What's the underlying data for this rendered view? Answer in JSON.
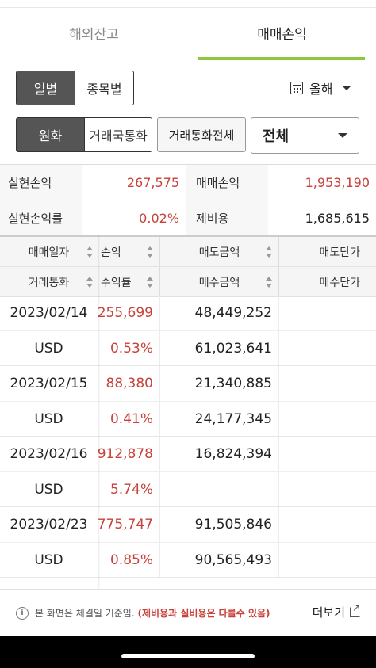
{
  "tabs": [
    {
      "label": "해외잔고",
      "active": false
    },
    {
      "label": "매매손익",
      "active": true
    }
  ],
  "accent_color": "#8dc63f",
  "loss_color": "#c8413a",
  "filters": {
    "period_type": {
      "options": [
        "일별",
        "종목별"
      ],
      "selected": "일별"
    },
    "period_label": "올해",
    "currency_type": {
      "options": [
        "원화",
        "거래국통화"
      ],
      "selected": "원화"
    },
    "currency_all_button": "거래통화전체",
    "select_value": "전체"
  },
  "summary": {
    "realized_pl_label": "실현손익",
    "realized_pl_value": "267,575",
    "trade_pl_label": "매매손익",
    "trade_pl_value": "1,953,190",
    "realized_rate_label": "실현손익률",
    "realized_rate_value": "0.02%",
    "fees_label": "제비용",
    "fees_value": "1,685,615"
  },
  "table": {
    "header_row1": [
      "매매일자",
      "손익",
      "매도금액",
      "매도단가"
    ],
    "header_row2": [
      "거래통화",
      "수익률",
      "매수금액",
      "매수단가"
    ],
    "rows": [
      {
        "date": "2023/02/14",
        "pl": "255,699",
        "sell": "48,449,252",
        "currency": "USD",
        "rate": "0.53%",
        "buy": "61,023,641"
      },
      {
        "date": "2023/02/15",
        "pl": "88,380",
        "sell": "21,340,885",
        "currency": "USD",
        "rate": "0.41%",
        "buy": "24,177,345"
      },
      {
        "date": "2023/02/16",
        "pl": "912,878",
        "sell": "16,824,394",
        "currency": "USD",
        "rate": "5.74%",
        "buy": ""
      },
      {
        "date": "2023/02/23",
        "pl": "775,747",
        "sell": "91,505,846",
        "currency": "USD",
        "rate": "0.85%",
        "buy": "90,565,493"
      }
    ]
  },
  "footer": {
    "notice_plain": "본 화면은 체결일 기준임.",
    "notice_emphasis": "(제비용과 실비용은 다를수 있음)",
    "more_label": "더보기"
  }
}
